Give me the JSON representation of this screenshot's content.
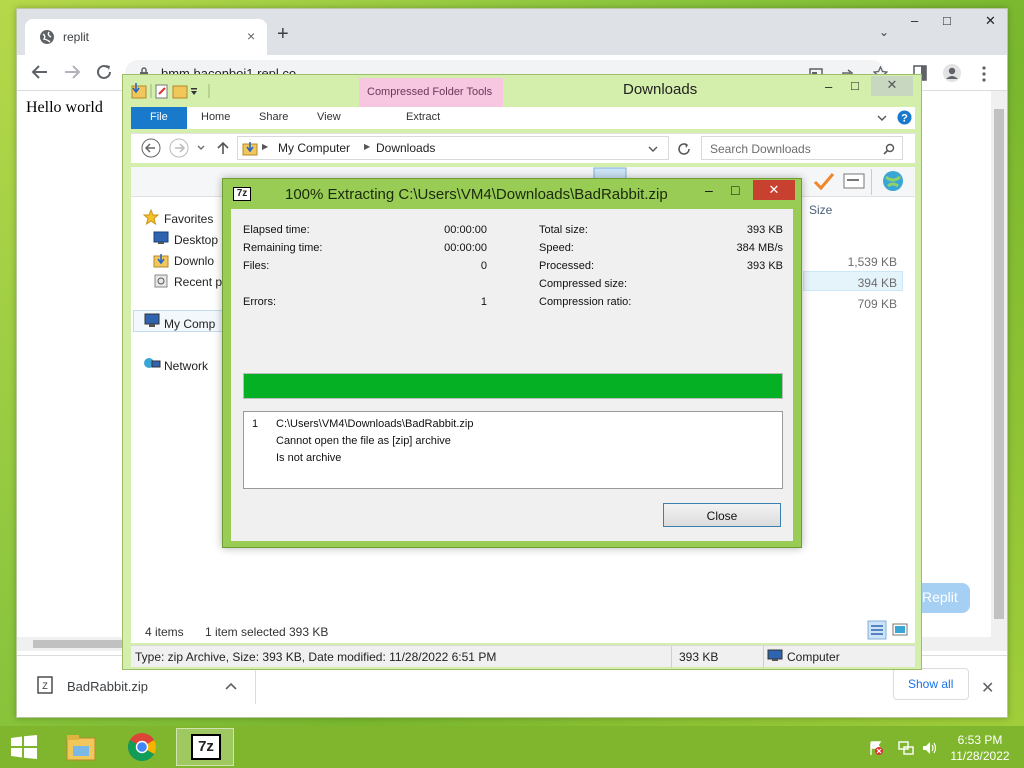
{
  "colors": {
    "desktop": "#8cc63e",
    "titlebar_green": "#99cc55",
    "progress": "#06b025",
    "file_tab": "#1979ca",
    "close_red": "#c8402f",
    "context_tab": "#f7c6e0"
  },
  "chrome": {
    "tab_title": "replit",
    "tab_close": "×",
    "new_tab": "+",
    "tab_menu": "⌄",
    "url": "bmm.baconboi1.repl.co",
    "page_text": "Hello world",
    "replit_button": "Replit",
    "download": {
      "filename": "BadRabbit.zip",
      "show_all": "Show all",
      "close": "✕"
    },
    "window_buttons": {
      "minimize": "–",
      "maximize": "□",
      "close": "✕"
    }
  },
  "explorer": {
    "title": "Downloads",
    "context_tab": "Compressed Folder Tools",
    "context_subtab": "Extract",
    "ribbon_tabs": [
      "File",
      "Home",
      "Share",
      "View"
    ],
    "breadcrumb": [
      "My Computer",
      "Downloads"
    ],
    "search_placeholder": "Search Downloads",
    "nav": {
      "favorites": "Favorites",
      "desktop": "Desktop",
      "downloads": "Downlo",
      "recent": "Recent p",
      "my_computer": "My Comp",
      "network": "Network"
    },
    "columns": {
      "size": "Size"
    },
    "file_sizes": [
      "1,539 KB",
      "394 KB",
      "709 KB"
    ],
    "status": {
      "items": "4 items",
      "selected": "1 item selected",
      "selected_size": "393 KB"
    },
    "details": {
      "info": "Type: zip Archive, Size: 393 KB, Date modified: 11/28/2022 6:51 PM",
      "size": "393 KB",
      "location": "Computer"
    }
  },
  "zip_dialog": {
    "title": "100% Extracting C:\\Users\\VM4\\Downloads\\BadRabbit.zip",
    "icon_text": "7z",
    "left_stats": [
      {
        "label": "Elapsed time:",
        "value": "00:00:00"
      },
      {
        "label": "Remaining time:",
        "value": "00:00:00"
      },
      {
        "label": "Files:",
        "value": "0"
      },
      {
        "label": "Errors:",
        "value": "1"
      }
    ],
    "right_stats": [
      {
        "label": "Total size:",
        "value": "393 KB"
      },
      {
        "label": "Speed:",
        "value": "384 MB/s"
      },
      {
        "label": "Processed:",
        "value": "393 KB"
      },
      {
        "label": "Compressed size:",
        "value": ""
      },
      {
        "label": "Compression ratio:",
        "value": ""
      }
    ],
    "progress_fraction": 1.0,
    "log": {
      "index": "1",
      "path": "C:\\Users\\VM4\\Downloads\\BadRabbit.zip",
      "line2": "Cannot open the file as [zip] archive",
      "line3": "Is not archive"
    },
    "close_label": "Close"
  },
  "taskbar": {
    "time": "6:53 PM",
    "date": "11/28/2022",
    "apps": [
      {
        "icon": "file-explorer-icon"
      },
      {
        "icon": "chrome-icon"
      },
      {
        "icon": "7zip-icon",
        "text": "7z"
      }
    ]
  }
}
